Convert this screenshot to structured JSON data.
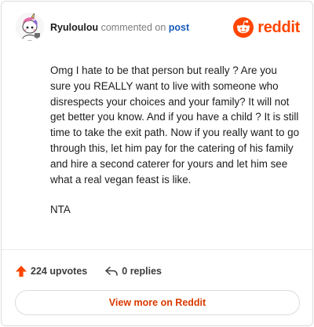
{
  "header": {
    "username": "Ryuloulou",
    "commented_on": "commented on",
    "post_link": "post",
    "brand": "reddit"
  },
  "comment": {
    "paragraphs": [
      "Omg I hate to be that person but really ? Are you sure you REALLY want to live with someone who disrespects your choices and your family? It will not get better you know. And if you have a child ? It is still time to take the exit path. Now if you really want to go through this, let him pay for the catering of his family and hire a second caterer for yours and let him see what a real vegan feast is like.",
      "NTA"
    ]
  },
  "footer": {
    "upvotes": "224 upvotes",
    "replies": "0 replies",
    "view_more": "View more on Reddit"
  },
  "colors": {
    "brand": "#ff4500",
    "link": "#1a5bb8",
    "upvote": "#ff4500"
  },
  "icons": {
    "avatar": "cartoon-avatar-icon",
    "brand": "reddit-snoo-icon",
    "upvote": "upvote-arrow-icon",
    "reply": "reply-arrow-icon"
  }
}
